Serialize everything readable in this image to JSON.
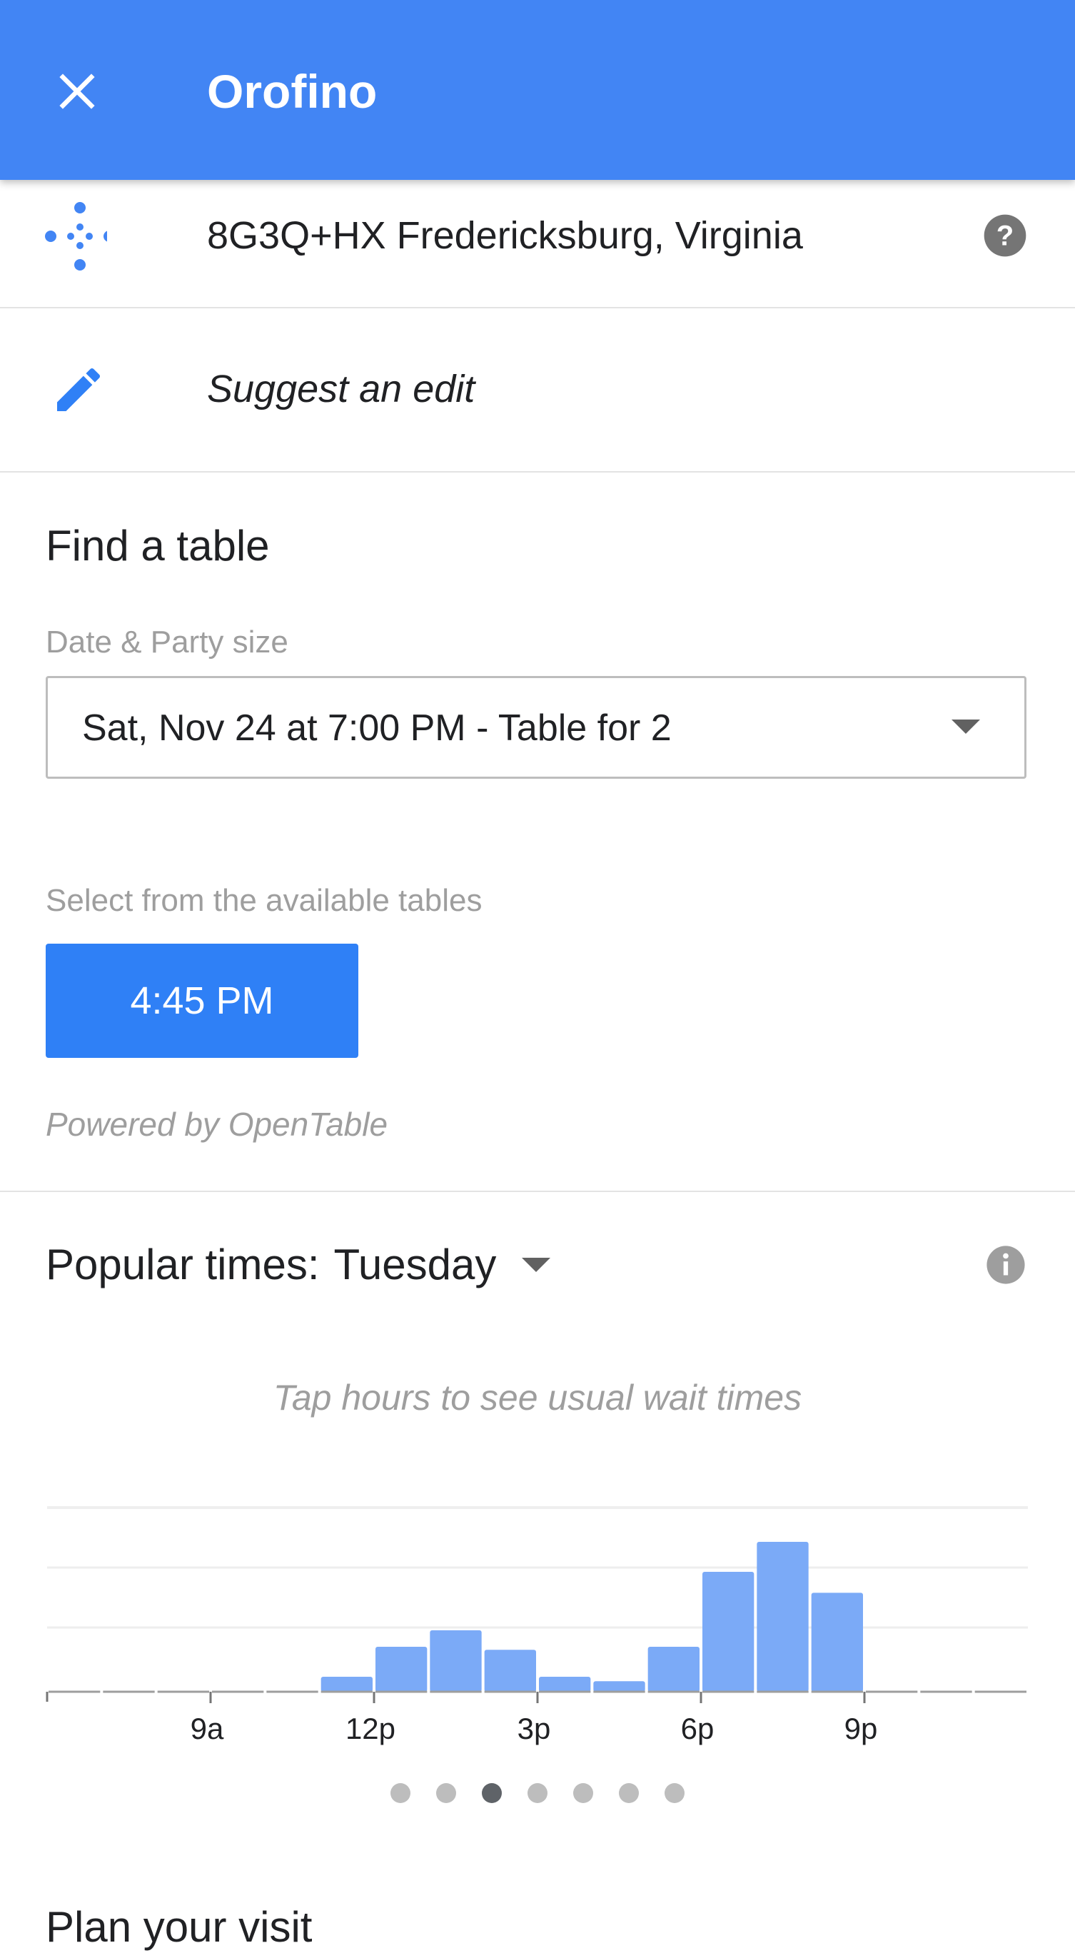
{
  "app_bar": {
    "title": "Orofino",
    "close_icon": "close-icon"
  },
  "plus_code": {
    "text": "8G3Q+HX Fredericksburg, Virginia",
    "icon": "plus-code-icon",
    "help_icon": "help-icon"
  },
  "edit": {
    "text": "Suggest an edit",
    "icon": "pencil-icon"
  },
  "find_table": {
    "title": "Find a table",
    "date_label": "Date & Party size",
    "selected": "Sat, Nov 24 at 7:00 PM - Table for 2",
    "available_label": "Select from the available tables",
    "times": [
      "4:45 PM"
    ],
    "powered_by": "Powered by OpenTable"
  },
  "popular_times": {
    "label": "Popular times:",
    "day": "Tuesday",
    "hint": "Tap hours to see usual wait times",
    "pages": 7,
    "active_page": 2
  },
  "plan": {
    "title": "Plan your visit"
  },
  "colors": {
    "app_bar": "#4285f4",
    "accent": "#2f80f6",
    "bar": "#7baaf7"
  },
  "chart_data": {
    "type": "bar",
    "title": "",
    "xlabel": "",
    "ylabel": "",
    "categories": [
      "6a",
      "7a",
      "8a",
      "9a",
      "10a",
      "11a",
      "12p",
      "1p",
      "2p",
      "3p",
      "4p",
      "5p",
      "6p",
      "7p",
      "8p",
      "9p",
      "10p",
      "11p"
    ],
    "tick_labels": [
      "9a",
      "12p",
      "3p",
      "6p",
      "9p"
    ],
    "values": [
      0,
      0,
      0,
      0,
      0,
      10,
      30,
      41,
      28,
      10,
      7,
      30,
      80,
      100,
      66,
      0,
      0,
      0
    ],
    "ylim": [
      0,
      100
    ],
    "grid": true,
    "legend": "none"
  }
}
